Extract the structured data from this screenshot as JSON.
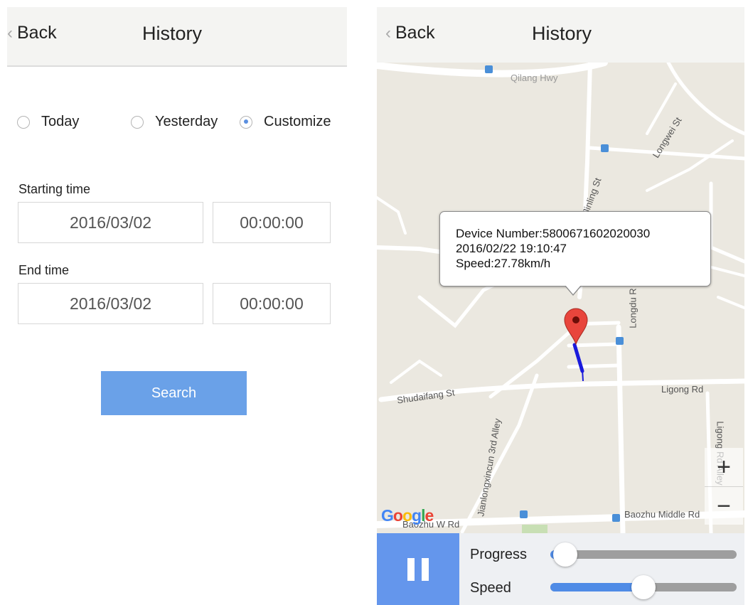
{
  "left_screen": {
    "header": {
      "back_label": "Back",
      "title": "History"
    },
    "date_options": [
      {
        "label": "Today",
        "selected": false
      },
      {
        "label": "Yesterday",
        "selected": false
      },
      {
        "label": "Customize",
        "selected": true
      }
    ],
    "start": {
      "label": "Starting time",
      "date": "2016/03/02",
      "time": "00:00:00"
    },
    "end": {
      "label": "End time",
      "date": "2016/03/02",
      "time": "00:00:00"
    },
    "search_label": "Search",
    "accent_color": "#6aa1e8"
  },
  "right_screen": {
    "header": {
      "back_label": "Back",
      "title": "History"
    },
    "map": {
      "popup": {
        "device": "Device Number:5800671602020030",
        "datetime": "2016/02/22 19:10:47",
        "speed": "Speed:27.78km/h"
      },
      "roads": [
        "Qilang Hwy",
        "Longwei St",
        "Jinling St",
        "Longdu R",
        "Shudaifang St",
        "Ligong Rd",
        "Ligong Rd Alley",
        "Jianlongxincun 3rd Alley",
        "Baozhu W Rd",
        "Baozhu Middle Rd"
      ],
      "zoom_in": "+",
      "zoom_out": "−",
      "attribution": "Google",
      "marker_icon": "map-pin-icon",
      "track_color": "#1a1adc"
    },
    "controls": {
      "progress_label": "Progress",
      "progress_value": 0.08,
      "speed_label": "Speed",
      "speed_value": 0.5,
      "accent_color": "#6496ec"
    }
  }
}
